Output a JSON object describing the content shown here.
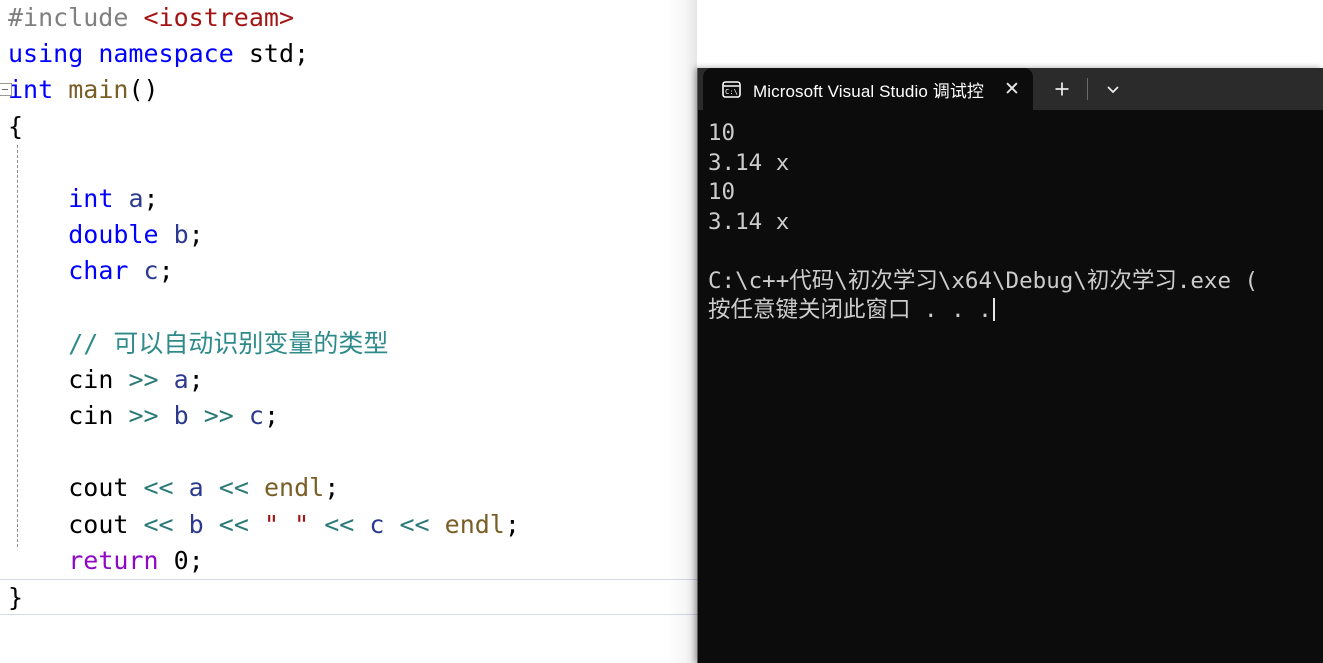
{
  "editor": {
    "name": "visual-studio-code-editor",
    "background": "#ffffff",
    "lines": [
      {
        "id": "l1",
        "indent": 0,
        "tokens": [
          {
            "t": "#include",
            "c": "pre"
          },
          {
            "t": " ",
            "c": "plain"
          },
          {
            "t": "<iostream>",
            "c": "str"
          }
        ]
      },
      {
        "id": "l2",
        "indent": 0,
        "tokens": [
          {
            "t": "using",
            "c": "kw"
          },
          {
            "t": " ",
            "c": "plain"
          },
          {
            "t": "namespace",
            "c": "kw"
          },
          {
            "t": " std;",
            "c": "plain"
          }
        ]
      },
      {
        "id": "l3",
        "indent": 0,
        "collapse": true,
        "tokens": [
          {
            "t": "int",
            "c": "kw"
          },
          {
            "t": " ",
            "c": "plain"
          },
          {
            "t": "main",
            "c": "fn"
          },
          {
            "t": "()",
            "c": "plain"
          }
        ]
      },
      {
        "id": "l4",
        "indent": 0,
        "tokens": [
          {
            "t": "{",
            "c": "plain"
          }
        ]
      },
      {
        "id": "l5",
        "indent": 0,
        "tokens": [
          {
            "t": "",
            "c": "plain"
          }
        ]
      },
      {
        "id": "l6",
        "indent": 1,
        "tokens": [
          {
            "t": "int",
            "c": "kw"
          },
          {
            "t": " ",
            "c": "plain"
          },
          {
            "t": "a",
            "c": "ident"
          },
          {
            "t": ";",
            "c": "plain"
          }
        ]
      },
      {
        "id": "l7",
        "indent": 1,
        "tokens": [
          {
            "t": "double",
            "c": "kw"
          },
          {
            "t": " ",
            "c": "plain"
          },
          {
            "t": "b",
            "c": "ident"
          },
          {
            "t": ";",
            "c": "plain"
          }
        ]
      },
      {
        "id": "l8",
        "indent": 1,
        "tokens": [
          {
            "t": "char",
            "c": "kw"
          },
          {
            "t": " ",
            "c": "plain"
          },
          {
            "t": "c",
            "c": "ident"
          },
          {
            "t": ";",
            "c": "plain"
          }
        ]
      },
      {
        "id": "l9",
        "indent": 0,
        "tokens": [
          {
            "t": "",
            "c": "plain"
          }
        ]
      },
      {
        "id": "l10",
        "indent": 1,
        "tokens": [
          {
            "t": "// 可以自动识别变量的类型",
            "c": "cmt"
          }
        ]
      },
      {
        "id": "l11",
        "indent": 1,
        "tokens": [
          {
            "t": "cin",
            "c": "plain"
          },
          {
            "t": " ",
            "c": "plain"
          },
          {
            "t": ">>",
            "c": "op"
          },
          {
            "t": " ",
            "c": "plain"
          },
          {
            "t": "a",
            "c": "ident"
          },
          {
            "t": ";",
            "c": "plain"
          }
        ]
      },
      {
        "id": "l12",
        "indent": 1,
        "tokens": [
          {
            "t": "cin",
            "c": "plain"
          },
          {
            "t": " ",
            "c": "plain"
          },
          {
            "t": ">>",
            "c": "op"
          },
          {
            "t": " ",
            "c": "plain"
          },
          {
            "t": "b",
            "c": "ident"
          },
          {
            "t": " ",
            "c": "plain"
          },
          {
            "t": ">>",
            "c": "op"
          },
          {
            "t": " ",
            "c": "plain"
          },
          {
            "t": "c",
            "c": "ident"
          },
          {
            "t": ";",
            "c": "plain"
          }
        ]
      },
      {
        "id": "l13",
        "indent": 0,
        "tokens": [
          {
            "t": "",
            "c": "plain"
          }
        ]
      },
      {
        "id": "l14",
        "indent": 1,
        "tokens": [
          {
            "t": "cout",
            "c": "plain"
          },
          {
            "t": " ",
            "c": "plain"
          },
          {
            "t": "<<",
            "c": "op"
          },
          {
            "t": " ",
            "c": "plain"
          },
          {
            "t": "a",
            "c": "ident"
          },
          {
            "t": " ",
            "c": "plain"
          },
          {
            "t": "<<",
            "c": "op"
          },
          {
            "t": " ",
            "c": "plain"
          },
          {
            "t": "endl",
            "c": "fn"
          },
          {
            "t": ";",
            "c": "plain"
          }
        ]
      },
      {
        "id": "l15",
        "indent": 1,
        "tokens": [
          {
            "t": "cout",
            "c": "plain"
          },
          {
            "t": " ",
            "c": "plain"
          },
          {
            "t": "<<",
            "c": "op"
          },
          {
            "t": " ",
            "c": "plain"
          },
          {
            "t": "b",
            "c": "ident"
          },
          {
            "t": " ",
            "c": "plain"
          },
          {
            "t": "<<",
            "c": "op"
          },
          {
            "t": " ",
            "c": "plain"
          },
          {
            "t": "\" \"",
            "c": "str"
          },
          {
            "t": " ",
            "c": "plain"
          },
          {
            "t": "<<",
            "c": "op"
          },
          {
            "t": " ",
            "c": "plain"
          },
          {
            "t": "c",
            "c": "ident"
          },
          {
            "t": " ",
            "c": "plain"
          },
          {
            "t": "<<",
            "c": "op"
          },
          {
            "t": " ",
            "c": "plain"
          },
          {
            "t": "endl",
            "c": "fn"
          },
          {
            "t": ";",
            "c": "plain"
          }
        ]
      },
      {
        "id": "l16",
        "indent": 1,
        "tokens": [
          {
            "t": "return",
            "c": "ctl"
          },
          {
            "t": " ",
            "c": "plain"
          },
          {
            "t": "0",
            "c": "num"
          },
          {
            "t": ";",
            "c": "plain"
          }
        ]
      },
      {
        "id": "l17",
        "indent": 0,
        "current": true,
        "tokens": [
          {
            "t": "}",
            "c": "plain"
          }
        ]
      }
    ]
  },
  "terminal": {
    "name": "windows-terminal",
    "background": "#0c0c0c",
    "tabbar_background": "#2b2b2b",
    "tab": {
      "icon": "console-cmd-icon",
      "icon_text": "C:\\",
      "title": "Microsoft Visual Studio 调试控",
      "close_label": "✕"
    },
    "actions": {
      "new_tab_label": "+",
      "new_tab_icon": "plus-icon",
      "dropdown_label": "⌄",
      "dropdown_icon": "chevron-down-icon"
    },
    "output": [
      "10",
      "3.14 x",
      "10",
      "3.14 x",
      "",
      "C:\\c++代码\\初次学习\\x64\\Debug\\初次学习.exe (",
      "按任意键关闭此窗口 . . ."
    ]
  }
}
